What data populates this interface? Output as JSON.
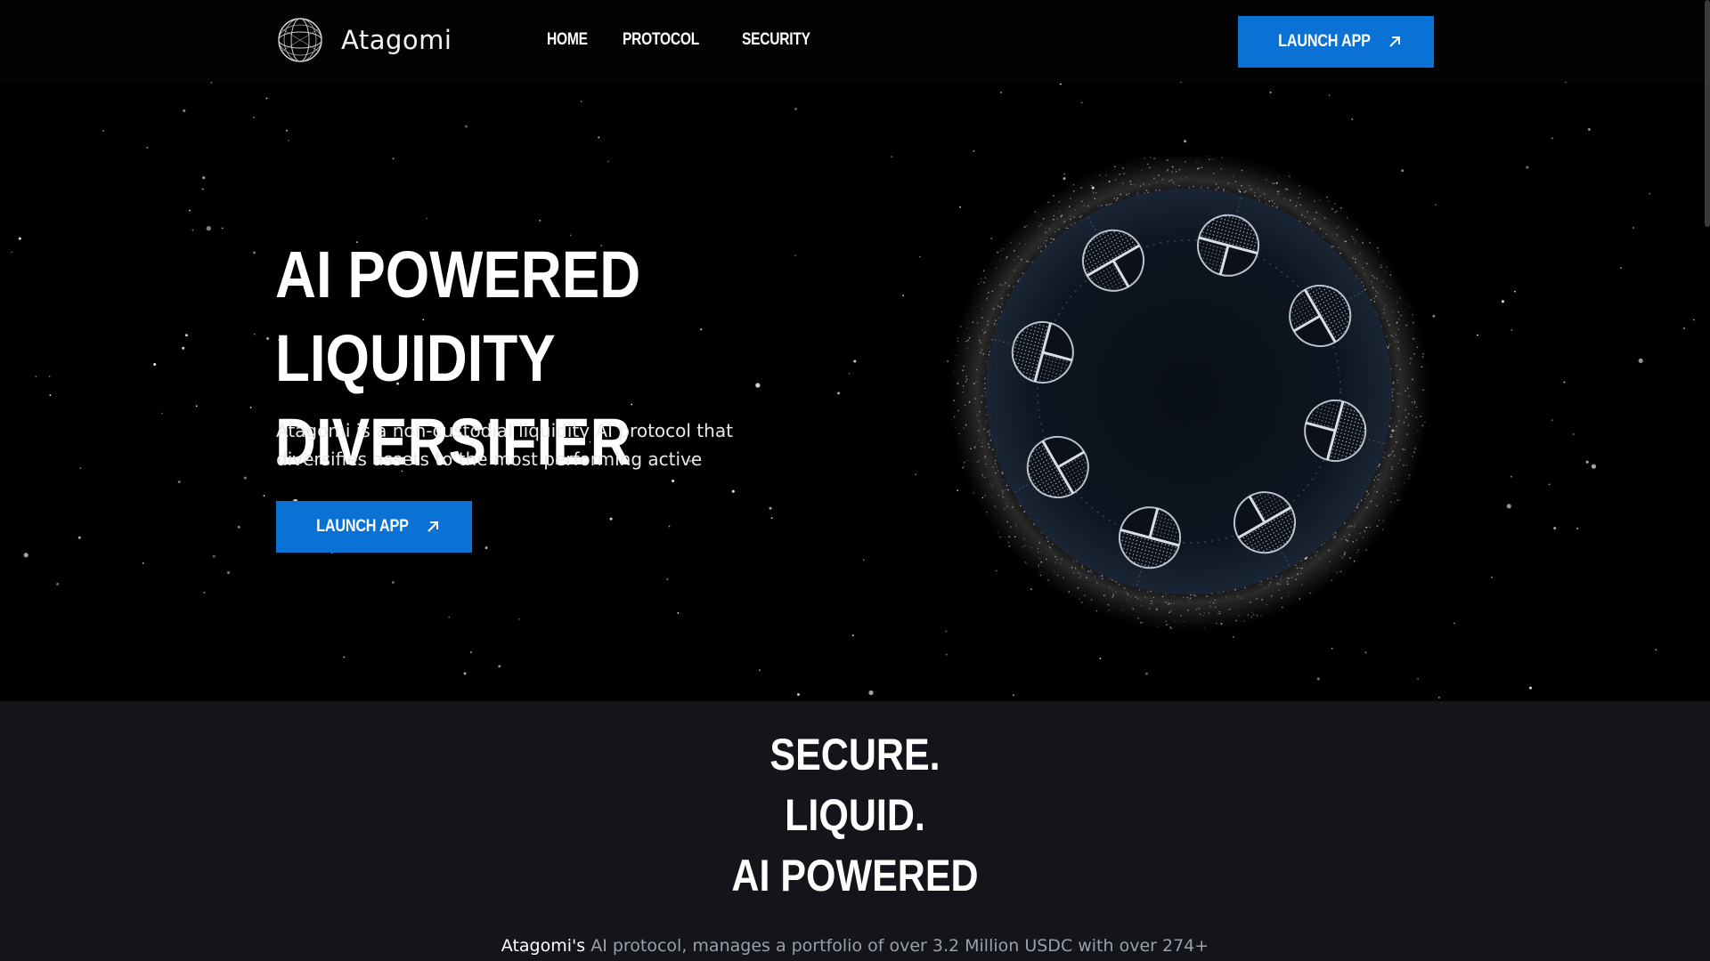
{
  "app": {
    "name": "Atagomi"
  },
  "nav": {
    "items": [
      {
        "label": "HOME"
      },
      {
        "label": "PROTOCOL"
      },
      {
        "label": "SECURITY"
      }
    ],
    "cta_label": "LAUNCH APP"
  },
  "hero": {
    "title_line1": "AI POWERED LIQUIDITY",
    "title_line2": "DIVERSIFIER",
    "description": "Atagomi is a non-custodial liquidity AI protocol that diversifies assets to the most performing active",
    "cta_label": "LAUNCH APP"
  },
  "features": {
    "lines": [
      "SECURE.",
      "LIQUID.",
      "AI POWERED"
    ],
    "desc_brand": "Atagomi's",
    "desc_rest": " AI protocol, manages a portfolio of over 3.2 Million USDC with over 274+"
  },
  "colors": {
    "accent": "#0a72d4",
    "background": "#000000",
    "section_bg": "#13151a"
  },
  "icons": {
    "logo": "wireframe-globe-icon",
    "arrow": "arrow-up-right-icon"
  }
}
